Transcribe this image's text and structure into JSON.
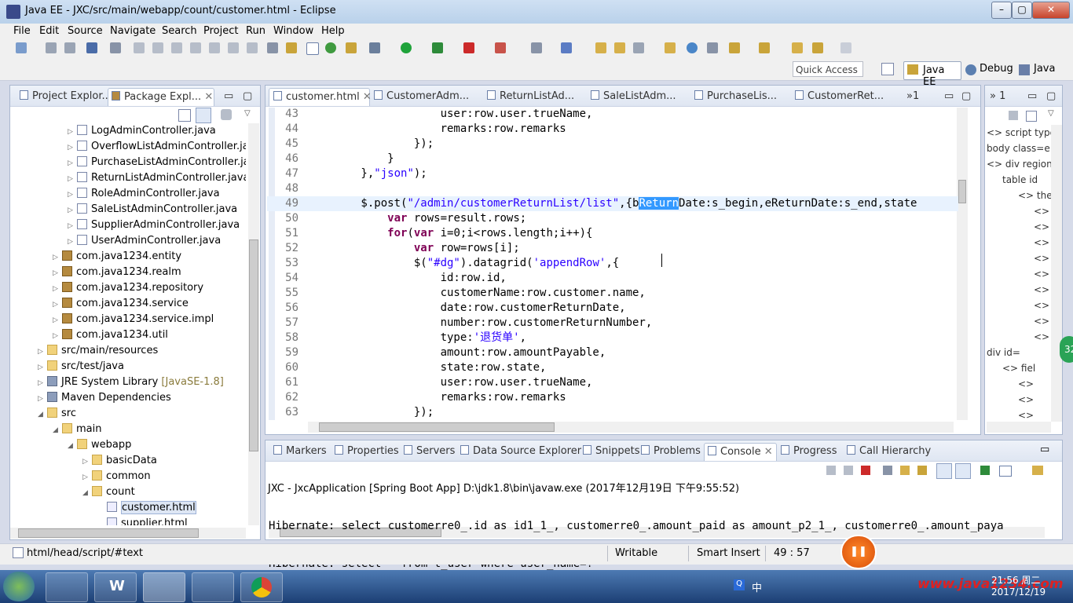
{
  "window": {
    "title": "Java EE - JXC/src/main/webapp/count/customer.html - Eclipse"
  },
  "menu": [
    "File",
    "Edit",
    "Source",
    "Navigate",
    "Search",
    "Project",
    "Run",
    "Window",
    "Help"
  ],
  "quick_access": "Quick Access",
  "perspectives": [
    "Java EE",
    "Debug",
    "Java"
  ],
  "left_tabs": [
    "Project Explor...",
    "Package Expl..."
  ],
  "tree": [
    {
      "label": "LogAdminController.java",
      "type": "java",
      "indent": 5,
      "arrow": "▷"
    },
    {
      "label": "OverflowListAdminController.java",
      "type": "java",
      "indent": 5,
      "arrow": "▷"
    },
    {
      "label": "PurchaseListAdminController.java",
      "type": "java",
      "indent": 5,
      "arrow": "▷"
    },
    {
      "label": "ReturnListAdminController.java",
      "type": "java",
      "indent": 5,
      "arrow": "▷"
    },
    {
      "label": "RoleAdminController.java",
      "type": "java",
      "indent": 5,
      "arrow": "▷"
    },
    {
      "label": "SaleListAdminController.java",
      "type": "java",
      "indent": 5,
      "arrow": "▷"
    },
    {
      "label": "SupplierAdminController.java",
      "type": "java",
      "indent": 5,
      "arrow": "▷"
    },
    {
      "label": "UserAdminController.java",
      "type": "java",
      "indent": 5,
      "arrow": "▷"
    },
    {
      "label": "com.java1234.entity",
      "type": "pkg",
      "indent": 4,
      "arrow": "▷"
    },
    {
      "label": "com.java1234.realm",
      "type": "pkg",
      "indent": 4,
      "arrow": "▷"
    },
    {
      "label": "com.java1234.repository",
      "type": "pkg",
      "indent": 4,
      "arrow": "▷"
    },
    {
      "label": "com.java1234.service",
      "type": "pkg",
      "indent": 4,
      "arrow": "▷"
    },
    {
      "label": "com.java1234.service.impl",
      "type": "pkg",
      "indent": 4,
      "arrow": "▷"
    },
    {
      "label": "com.java1234.util",
      "type": "pkg",
      "indent": 4,
      "arrow": "▷"
    },
    {
      "label": "src/main/resources",
      "type": "folder",
      "indent": 3,
      "arrow": "▷"
    },
    {
      "label": "src/test/java",
      "type": "folder",
      "indent": 3,
      "arrow": "▷"
    },
    {
      "label": "JRE System Library",
      "type": "lib",
      "indent": 3,
      "arrow": "▷",
      "extra": " [JavaSE-1.8]"
    },
    {
      "label": "Maven Dependencies",
      "type": "lib",
      "indent": 3,
      "arrow": "▷"
    },
    {
      "label": "src",
      "type": "folder",
      "indent": 3,
      "arrow": "◢"
    },
    {
      "label": "main",
      "type": "folder",
      "indent": 4,
      "arrow": "◢"
    },
    {
      "label": "webapp",
      "type": "folder",
      "indent": 5,
      "arrow": "◢"
    },
    {
      "label": "basicData",
      "type": "folder",
      "indent": 6,
      "arrow": "▷"
    },
    {
      "label": "common",
      "type": "folder",
      "indent": 6,
      "arrow": "▷"
    },
    {
      "label": "count",
      "type": "folder",
      "indent": 6,
      "arrow": "◢"
    },
    {
      "label": "customer.html",
      "type": "html",
      "indent": 7,
      "arrow": "",
      "selected": true
    },
    {
      "label": "supplier.html",
      "type": "html",
      "indent": 7,
      "arrow": ""
    }
  ],
  "editor_tabs": [
    "customer.html",
    "CustomerAdm...",
    "ReturnListAd...",
    "SaleListAdm...",
    "PurchaseLis...",
    "CustomerRet..."
  ],
  "editor_overflow": "»1",
  "code": [
    {
      "n": "43",
      "t": "                    user:row.user.trueName,"
    },
    {
      "n": "44",
      "t": "                    remarks:row.remarks"
    },
    {
      "n": "45",
      "t": "                });"
    },
    {
      "n": "46",
      "t": "            }"
    },
    {
      "n": "47",
      "t": "        },\"json\");"
    },
    {
      "n": "48",
      "t": ""
    },
    {
      "n": "49",
      "t": "        $.post(\"/admin/customerReturnList/list\",{bReturnDate:s_begin,eReturnDate:s_end,state"
    },
    {
      "n": "50",
      "t": "            var rows=result.rows;"
    },
    {
      "n": "51",
      "t": "            for(var i=0;i<rows.length;i++){"
    },
    {
      "n": "52",
      "t": "                var row=rows[i];"
    },
    {
      "n": "53",
      "t": "                $(\"#dg\").datagrid('appendRow',{"
    },
    {
      "n": "54",
      "t": "                    id:row.id,"
    },
    {
      "n": "55",
      "t": "                    customerName:row.customer.name,"
    },
    {
      "n": "56",
      "t": "                    date:row.customerReturnDate,"
    },
    {
      "n": "57",
      "t": "                    number:row.customerReturnNumber,"
    },
    {
      "n": "58",
      "t": "                    type:'退货单',"
    },
    {
      "n": "59",
      "t": "                    amount:row.amountPayable,"
    },
    {
      "n": "60",
      "t": "                    state:row.state,"
    },
    {
      "n": "61",
      "t": "                    user:row.user.trueName,"
    },
    {
      "n": "62",
      "t": "                    remarks:row.remarks"
    },
    {
      "n": "63",
      "t": "                });"
    }
  ],
  "outline_tab": "1",
  "outline": [
    "<> script type",
    "body class=e",
    "<> div region",
    "table id",
    "<> the",
    "<>",
    "<>",
    "<>",
    "<>",
    "<>",
    "<>",
    "<>",
    "<>",
    "<>",
    "div id=",
    "<> fiel",
    "<>",
    "<>",
    "<>"
  ],
  "bottom_tabs": [
    "Markers",
    "Properties",
    "Servers",
    "Data Source Explorer",
    "Snippets",
    "Problems",
    "Console",
    "Progress",
    "Call Hierarchy"
  ],
  "console_title": "JXC - JxcApplication [Spring Boot App] D:\\jdk1.8\\bin\\javaw.exe (2017年12月19日 下午9:55:52)",
  "console_lines": [
    "Hibernate: select customerre0_.id as id1_1_, customerre0_.amount_paid as amount_p2_1_, customerre0_.amount_paya",
    "Hibernate: select * from t_user where user_name=?"
  ],
  "status": {
    "path": "html/head/script/#text",
    "writable": "Writable",
    "insert": "Smart Insert",
    "position": "49 : 57"
  },
  "taskbar": {
    "ime": "中",
    "time": "21:56 周二",
    "date": "2017/12/19",
    "watermark": "www.java1234.com",
    "badge": "32"
  }
}
